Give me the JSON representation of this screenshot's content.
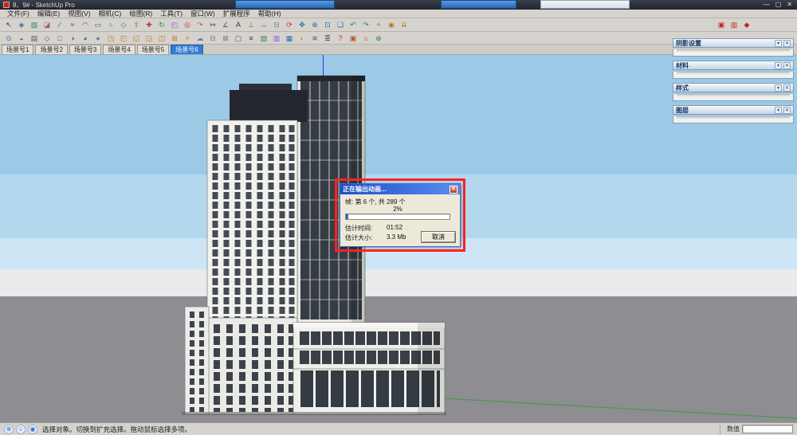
{
  "window": {
    "title": "8、9# - SketchUp Pro",
    "minimize_glyph": "—",
    "maximize_glyph": "▢",
    "close_glyph": "✕"
  },
  "menu": {
    "items": [
      {
        "name": "menu-file",
        "label": "文件(F)"
      },
      {
        "name": "menu-edit",
        "label": "编辑(E)"
      },
      {
        "name": "menu-view",
        "label": "视图(V)"
      },
      {
        "name": "menu-camera",
        "label": "相机(C)"
      },
      {
        "name": "menu-draw",
        "label": "绘图(R)"
      },
      {
        "name": "menu-tools",
        "label": "工具(T)"
      },
      {
        "name": "menu-window",
        "label": "窗口(W)"
      },
      {
        "name": "menu-extensions",
        "label": "扩展程序"
      },
      {
        "name": "menu-help",
        "label": "帮助(H)"
      }
    ]
  },
  "toolbar_row1": {
    "items": [
      {
        "name": "select-tool",
        "glyph": "↖",
        "color": "#333333"
      },
      {
        "name": "make-component-icon",
        "glyph": "◈",
        "color": "#2b6cb0"
      },
      {
        "name": "paint-bucket-icon",
        "glyph": "▨",
        "color": "#2f855a"
      },
      {
        "name": "eraser-tool",
        "glyph": "◪",
        "color": "#a05a78"
      },
      {
        "name": "line-tool",
        "glyph": "∕",
        "color": "#444444"
      },
      {
        "name": "freehand-tool",
        "glyph": "≈",
        "color": "#444444"
      },
      {
        "name": "arc-tool",
        "glyph": "◠",
        "color": "#444444"
      },
      {
        "name": "rectangle-tool",
        "glyph": "▭",
        "color": "#2b6cb0"
      },
      {
        "name": "circle-tool",
        "glyph": "○",
        "color": "#2b6cb0"
      },
      {
        "name": "polygon-tool",
        "glyph": "◇",
        "color": "#2b6cb0"
      },
      {
        "name": "push-pull-tool",
        "glyph": "⇧",
        "color": "#c05621"
      },
      {
        "name": "move-tool",
        "glyph": "✚",
        "color": "#c53030"
      },
      {
        "name": "rotate-tool",
        "glyph": "↻",
        "color": "#2f855a"
      },
      {
        "name": "scale-tool",
        "glyph": "◰",
        "color": "#805ad5"
      },
      {
        "name": "offset-tool",
        "glyph": "◎",
        "color": "#c53030"
      },
      {
        "name": "follow-me-tool",
        "glyph": "↷",
        "color": "#c05621"
      },
      {
        "name": "tape-measure-tool",
        "glyph": "↦",
        "color": "#4a5568"
      },
      {
        "name": "protractor-tool",
        "glyph": "∠",
        "color": "#4a5568"
      },
      {
        "name": "text-tool",
        "glyph": "A",
        "color": "#2d3748"
      },
      {
        "name": "axes-tool",
        "glyph": "⊥",
        "color": "#c53030"
      },
      {
        "name": "dimension-tool",
        "glyph": "↔",
        "color": "#4a5568"
      },
      {
        "name": "section-plane-tool",
        "glyph": "⊟",
        "color": "#718096"
      },
      {
        "name": "orbit-tool",
        "glyph": "⟳",
        "color": "#c53030"
      },
      {
        "name": "pan-tool",
        "glyph": "✥",
        "color": "#2b6cb0"
      },
      {
        "name": "zoom-tool",
        "glyph": "⊕",
        "color": "#2b6cb0"
      },
      {
        "name": "zoom-window-tool",
        "glyph": "⊡",
        "color": "#2b6cb0"
      },
      {
        "name": "zoom-extents-tool",
        "glyph": "❏",
        "color": "#2b6cb0"
      },
      {
        "name": "previous-view-icon",
        "glyph": "↶",
        "color": "#2f855a"
      },
      {
        "name": "next-view-icon",
        "glyph": "↷",
        "color": "#2f855a"
      },
      {
        "name": "position-camera-tool",
        "glyph": "⌖",
        "color": "#b7791f"
      },
      {
        "name": "look-around-tool",
        "glyph": "◉",
        "color": "#b7791f"
      },
      {
        "name": "walk-tool",
        "glyph": "⇊",
        "color": "#b7791f"
      }
    ]
  },
  "toolbar_row1_right": {
    "items": [
      {
        "name": "send-to-layout-icon",
        "glyph": "▣",
        "color": "#c0281e"
      },
      {
        "name": "style-builder-icon",
        "glyph": "▥",
        "color": "#c0281e"
      },
      {
        "name": "extension-warehouse-icon",
        "glyph": "◆",
        "color": "#c0281e"
      }
    ]
  },
  "toolbar_row2": {
    "items": [
      {
        "name": "entity-info-icon",
        "glyph": "⊙",
        "color": "#2b6cb0"
      },
      {
        "name": "model-info-icon",
        "glyph": "◒",
        "color": "#2b6cb0"
      },
      {
        "name": "x-ray-mode-icon",
        "glyph": "▤",
        "color": "#4a5568"
      },
      {
        "name": "wireframe-mode-icon",
        "glyph": "◇",
        "color": "#4a5568"
      },
      {
        "name": "hidden-line-mode-icon",
        "glyph": "□",
        "color": "#4a5568"
      },
      {
        "name": "shaded-mode-icon",
        "glyph": "◑",
        "color": "#2b6cb0"
      },
      {
        "name": "textured-mode-icon",
        "glyph": "◕",
        "color": "#2f855a"
      },
      {
        "name": "monochrome-mode-icon",
        "glyph": "●",
        "color": "#718096"
      },
      {
        "name": "iso-view-icon",
        "glyph": "◳",
        "color": "#b7791f"
      },
      {
        "name": "top-view-icon",
        "glyph": "◰",
        "color": "#b7791f"
      },
      {
        "name": "front-view-icon",
        "glyph": "◱",
        "color": "#b7791f"
      },
      {
        "name": "right-view-icon",
        "glyph": "◲",
        "color": "#b7791f"
      },
      {
        "name": "back-view-icon",
        "glyph": "◫",
        "color": "#b7791f"
      },
      {
        "name": "left-view-icon",
        "glyph": "⊞",
        "color": "#b7791f"
      },
      {
        "name": "shadows-toggle-icon",
        "glyph": "☀",
        "color": "#d69e2e"
      },
      {
        "name": "fog-toggle-icon",
        "glyph": "☁",
        "color": "#718096"
      },
      {
        "name": "section-display-icon",
        "glyph": "⊟",
        "color": "#718096"
      },
      {
        "name": "section-cut-icon",
        "glyph": "⊠",
        "color": "#718096"
      },
      {
        "name": "hide-similar-icon",
        "glyph": "▢",
        "color": "#4a5568"
      },
      {
        "name": "layers-panel-icon",
        "glyph": "≡",
        "color": "#2d3748"
      },
      {
        "name": "materials-panel-icon",
        "glyph": "▧",
        "color": "#2f855a"
      },
      {
        "name": "styles-panel-icon",
        "glyph": "▥",
        "color": "#805ad5"
      },
      {
        "name": "scenes-panel-icon",
        "glyph": "▦",
        "color": "#2b6cb0"
      },
      {
        "name": "shadow-settings-panel-icon",
        "glyph": "◐",
        "color": "#d69e2e"
      },
      {
        "name": "soften-edges-icon",
        "glyph": "≋",
        "color": "#4a5568"
      },
      {
        "name": "outliner-icon",
        "glyph": "≣",
        "color": "#4a5568"
      },
      {
        "name": "instructor-icon",
        "glyph": "?",
        "color": "#c53030"
      },
      {
        "name": "match-photo-icon",
        "glyph": "▣",
        "color": "#c05621"
      },
      {
        "name": "3d-warehouse-icon",
        "glyph": "⌂",
        "color": "#c53030"
      },
      {
        "name": "add-location-icon",
        "glyph": "⊕",
        "color": "#2f855a"
      }
    ]
  },
  "scene_tabs": {
    "active_index": 5,
    "items": [
      {
        "name": "scene-tab-1",
        "label": "场景号1"
      },
      {
        "name": "scene-tab-2",
        "label": "场景号2"
      },
      {
        "name": "scene-tab-3",
        "label": "场景号3"
      },
      {
        "name": "scene-tab-4",
        "label": "场景号4"
      },
      {
        "name": "scene-tab-5",
        "label": "场景号5"
      },
      {
        "name": "scene-tab-6",
        "label": "场景号6"
      }
    ]
  },
  "trays": {
    "collapse_glyph": "▾",
    "close_glyph": "✕",
    "items": [
      {
        "name": "tray-shadow-settings",
        "title": "阴影设置"
      },
      {
        "name": "tray-materials",
        "title": "材料"
      },
      {
        "name": "tray-styles",
        "title": "样式"
      },
      {
        "name": "tray-layers",
        "title": "图层"
      }
    ]
  },
  "dialog": {
    "title": "正在输出动画...",
    "close_glyph": "✕",
    "frame_line": "帧: 第 6 个, 共 289 个",
    "progress_text": "2%",
    "progress_percent": 2,
    "eta_label": "估计时间:",
    "eta_value": "01:52",
    "size_label": "估计大小:",
    "size_value": "3.3 Mb",
    "cancel_label": "取消"
  },
  "statusbar": {
    "hint": "选择对象。切换到扩充选择。拖动鼠标选择多项。",
    "measurement_label": "数值",
    "measurement_value": "",
    "icons": [
      {
        "name": "geolocation-icon",
        "glyph": "⊕",
        "color": "#2e6fc2"
      },
      {
        "name": "credits-icon",
        "glyph": "☺",
        "color": "#2e6fc2"
      },
      {
        "name": "help-icon",
        "glyph": "◉",
        "color": "#2e6fc2"
      }
    ]
  },
  "colors": {
    "active_tab": "#2f7cd6",
    "annotation_red": "#ff2222",
    "progress_blue": "#3a58c8",
    "sky_blue": "#9cc9e6",
    "ground_gray": "#8d8d92",
    "dialog_title_blue": "#1c50c8"
  }
}
